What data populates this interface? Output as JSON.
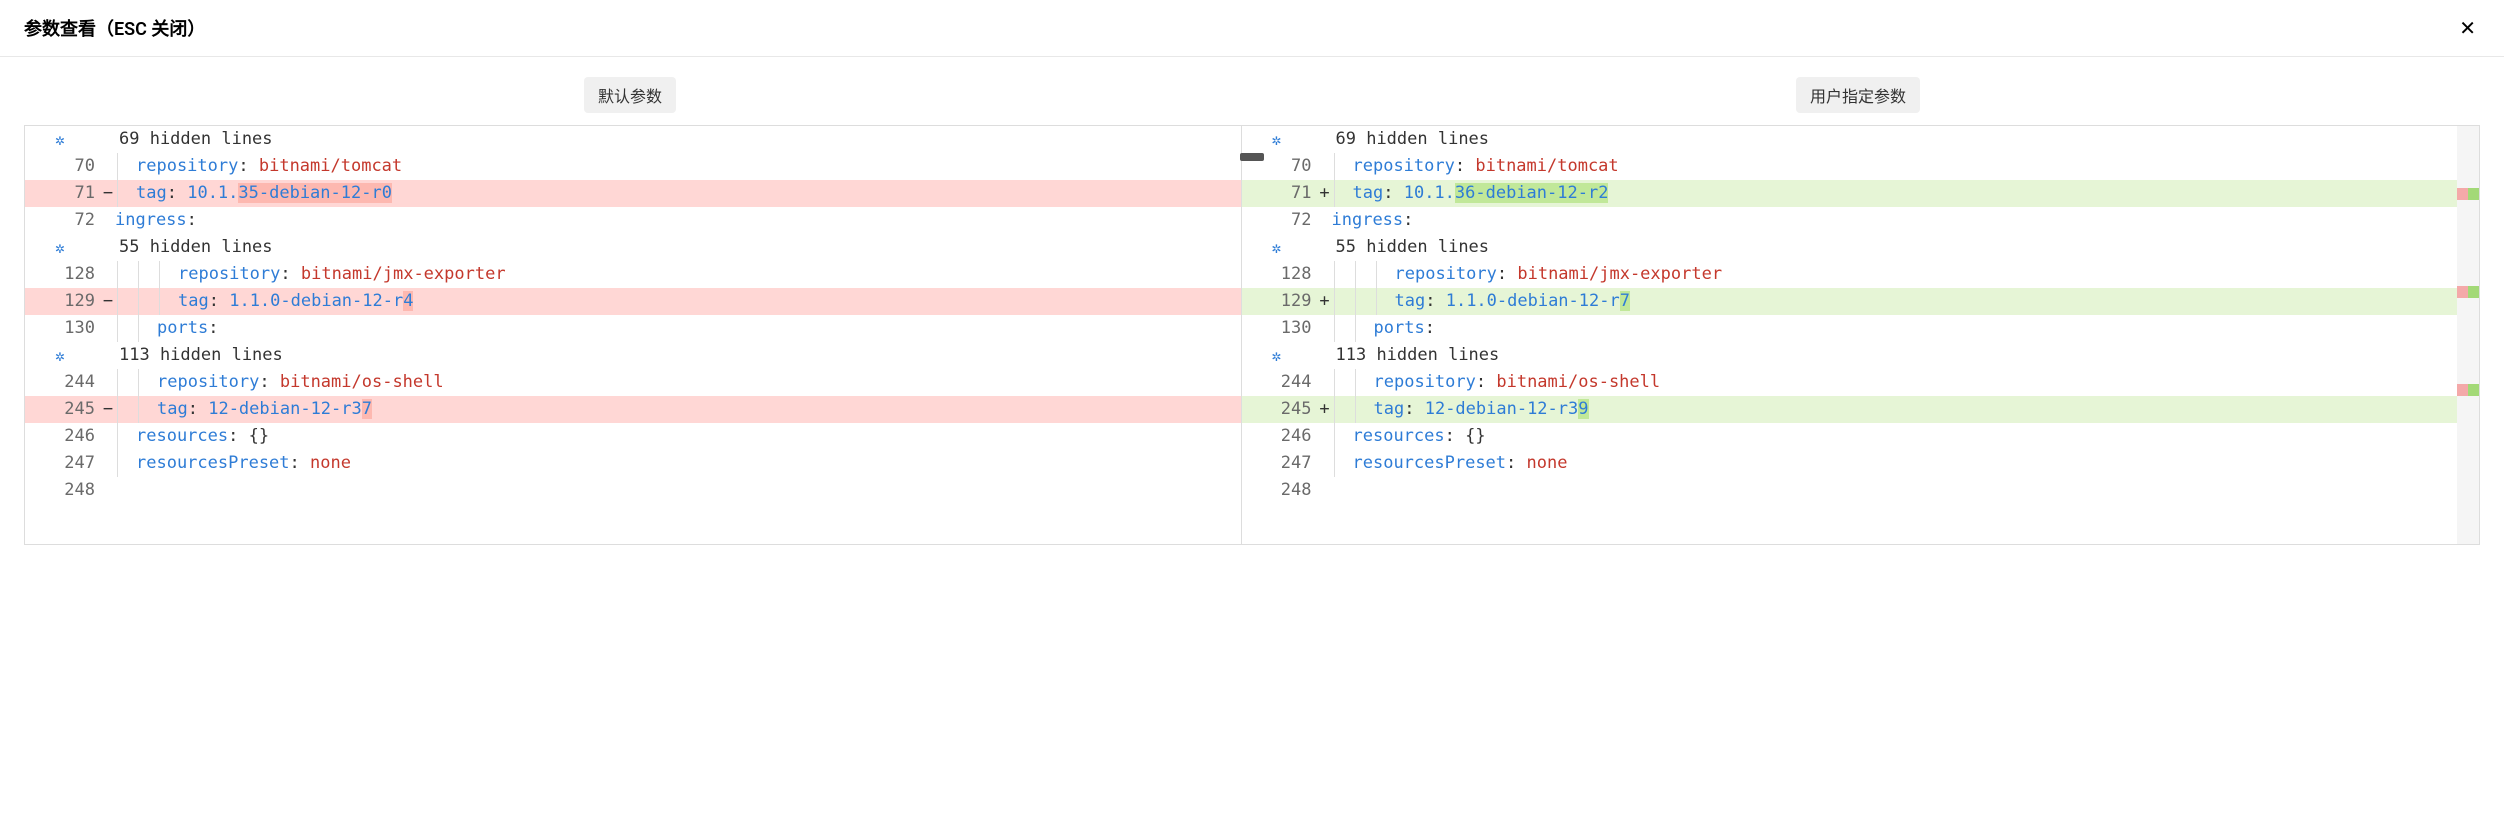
{
  "header": {
    "title": "参数查看（ESC 关闭）"
  },
  "tabs": {
    "left": "默认参数",
    "right": "用户指定参数"
  },
  "hidden": {
    "h1": "69 hidden lines",
    "h2": "55 hidden lines",
    "h3": "113 hidden lines"
  },
  "lines": {
    "l70": "70",
    "l71": "71",
    "l72": "72",
    "l128": "128",
    "l129": "129",
    "l130": "130",
    "l244": "244",
    "l245": "245",
    "l246": "246",
    "l247": "247",
    "l248": "248"
  },
  "left": {
    "r70_key": "repository",
    "r70_val": "bitnami/tomcat",
    "r71_key": "tag",
    "r71_pre": "10.1.",
    "r71_hl": "35-debian-12-r0",
    "r72_key": "ingress",
    "r128_key": "repository",
    "r128_val": "bitnami/jmx-exporter",
    "r129_key": "tag",
    "r129_pre": "1.1.0-debian-12-r",
    "r129_hl": "4",
    "r130_key": "ports",
    "r244_key": "repository",
    "r244_val": "bitnami/os-shell",
    "r245_key": "tag",
    "r245_pre": "12-debian-12-r3",
    "r245_hl": "7",
    "r246_key": "resources",
    "r246_val": "{}",
    "r247_key": "resourcesPreset",
    "r247_val": "none"
  },
  "right": {
    "r70_key": "repository",
    "r70_val": "bitnami/tomcat",
    "r71_key": "tag",
    "r71_pre": "10.1.",
    "r71_hl": "36-debian-12-r2",
    "r72_key": "ingress",
    "r128_key": "repository",
    "r128_val": "bitnami/jmx-exporter",
    "r129_key": "tag",
    "r129_pre": "1.1.0-debian-12-r",
    "r129_hl": "7",
    "r130_key": "ports",
    "r244_key": "repository",
    "r244_val": "bitnami/os-shell",
    "r245_key": "tag",
    "r245_pre": "12-debian-12-r3",
    "r245_hl": "9",
    "r246_key": "resources",
    "r246_val": "{}",
    "r247_key": "resourcesPreset",
    "r247_val": "none"
  },
  "markers": {
    "minus": "−",
    "plus": "+"
  }
}
